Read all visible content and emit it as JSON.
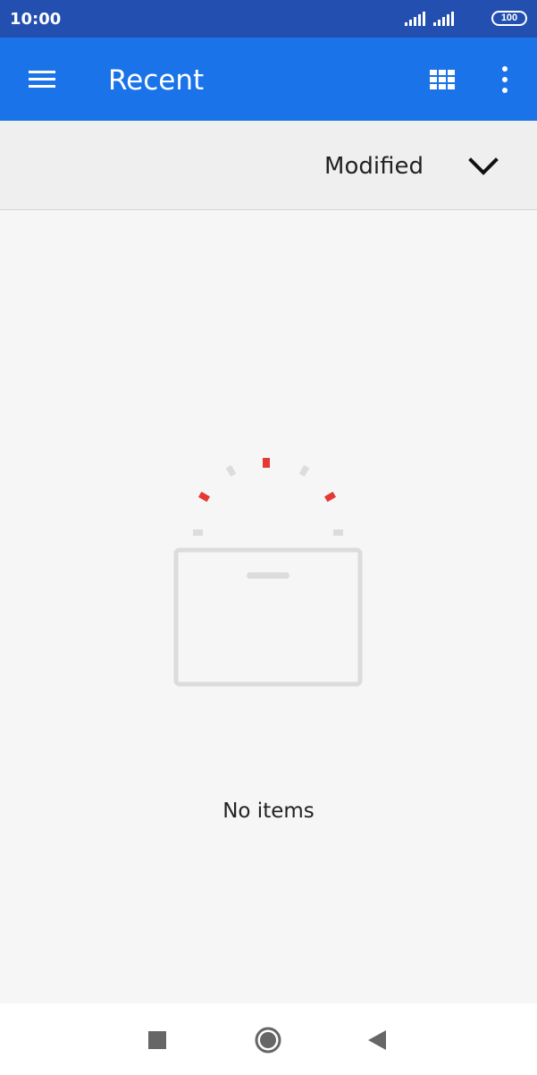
{
  "status_bar": {
    "time": "10:00",
    "battery": "100",
    "icons": [
      "signal-icon",
      "signal-icon",
      "battery-icon"
    ]
  },
  "app_bar": {
    "title": "Recent",
    "icons": [
      "menu-icon",
      "grid-view-icon",
      "more-vert-icon"
    ]
  },
  "sort_bar": {
    "label": "Modified",
    "icon": "chevron-down-icon"
  },
  "empty_state": {
    "text": "No items",
    "icon": "empty-box-icon"
  },
  "nav_bar": {
    "icons": [
      "recents-square-icon",
      "home-circle-icon",
      "back-triangle-icon"
    ]
  },
  "colors": {
    "status_bar": "#2350b0",
    "app_bar": "#1a73e8",
    "accent_red": "#e53935",
    "illustration_grey": "#dcdcdc",
    "background": "#f6f6f6"
  }
}
